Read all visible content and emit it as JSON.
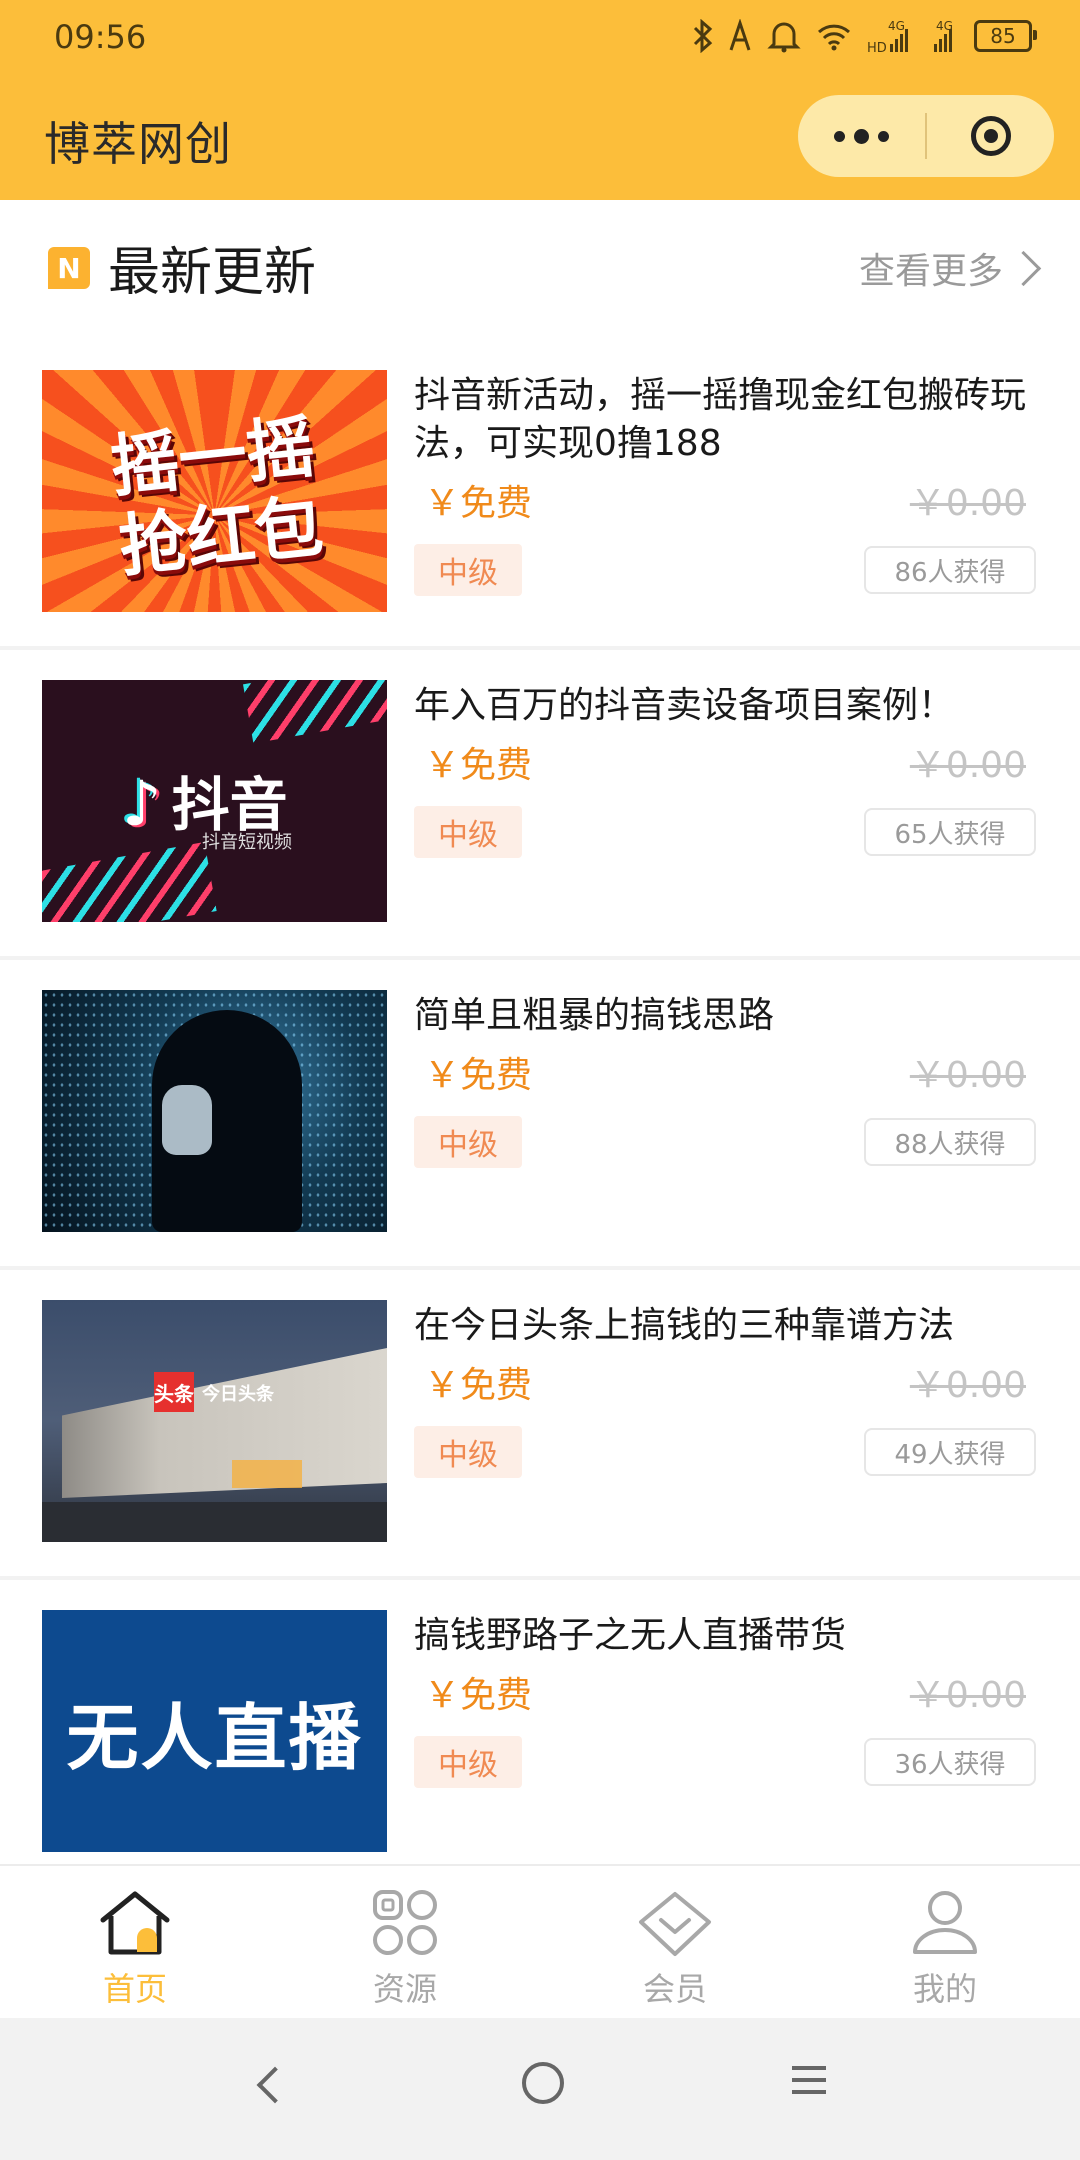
{
  "status_bar": {
    "time": "09:56",
    "battery": "85",
    "signal_a": "4G",
    "signal_b": "4G",
    "hd": "HD"
  },
  "nav": {
    "title": "博萃网创"
  },
  "section": {
    "title": "最新更新",
    "more_label": "查看更多",
    "badge": "N"
  },
  "items": [
    {
      "title": "抖音新活动，摇一摇撸现金红包搬砖玩法，可实现0撸188",
      "price": "￥免费",
      "original_price": "￥0.00",
      "level": "中级",
      "count": "86人获得",
      "thumb_text": "摇一摇抢红包"
    },
    {
      "title": "年入百万的抖音卖设备项目案例！",
      "price": "￥免费",
      "original_price": "￥0.00",
      "level": "中级",
      "count": "65人获得",
      "thumb_text": "抖音",
      "thumb_sub": "抖音短视频"
    },
    {
      "title": "简单且粗暴的搞钱思路",
      "price": "￥免费",
      "original_price": "￥0.00",
      "level": "中级",
      "count": "88人获得"
    },
    {
      "title": "在今日头条上搞钱的三种靠谱方法",
      "price": "￥免费",
      "original_price": "￥0.00",
      "level": "中级",
      "count": "49人获得",
      "thumb_text": "头条",
      "thumb_sub": "今日头条"
    },
    {
      "title": "搞钱野路子之无人直播带货",
      "price": "￥免费",
      "original_price": "￥0.00",
      "level": "中级",
      "count": "36人获得",
      "thumb_text": "无人直播"
    }
  ],
  "tabs": [
    {
      "label": "首页",
      "icon": "home-icon",
      "active": true
    },
    {
      "label": "资源",
      "icon": "grid-icon",
      "active": false
    },
    {
      "label": "会员",
      "icon": "vip-diamond-icon",
      "active": false
    },
    {
      "label": "我的",
      "icon": "user-icon",
      "active": false
    }
  ],
  "colors": {
    "accent": "#fcbe3a",
    "price": "#f08a1a",
    "level_bg": "#fdeee6"
  }
}
